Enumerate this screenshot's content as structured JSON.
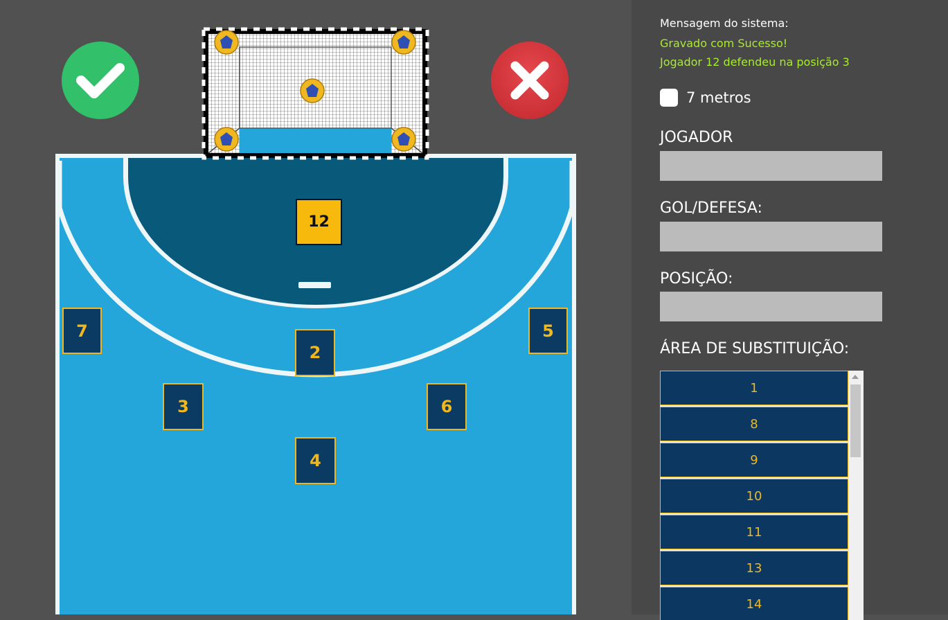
{
  "court": {
    "colors": {
      "floor": "#25a6da",
      "goal_area": "#08597a",
      "lines": "#eef6f8",
      "spot_accent": "#f0b820",
      "keeper": "#f7ba0c"
    },
    "keeper_label": "12",
    "positions": [
      "7",
      "5",
      "2",
      "3",
      "6",
      "4"
    ],
    "goal_balls": [
      "top-left",
      "top-right",
      "center",
      "bottom-left",
      "bottom-right"
    ],
    "confirm_icon": "check-icon",
    "cancel_icon": "close-icon"
  },
  "panel": {
    "system_message_title": "Mensagem do sistema:",
    "system_message_lines": [
      "Gravado com Sucesso!",
      "Jogador 12 defendeu na posição 3"
    ],
    "seven_meters_label": "7 metros",
    "seven_meters_checked": false,
    "player_label": "JOGADOR",
    "goal_defense_label": "GOL/DEFESA:",
    "position_label": "POSIÇÃO:",
    "player_value": "",
    "goal_defense_value": "",
    "position_value": "",
    "substitution_label": "ÁREA DE SUBSTITUIÇÃO:",
    "substitutes": [
      "1",
      "8",
      "9",
      "10",
      "11",
      "13",
      "14"
    ]
  }
}
